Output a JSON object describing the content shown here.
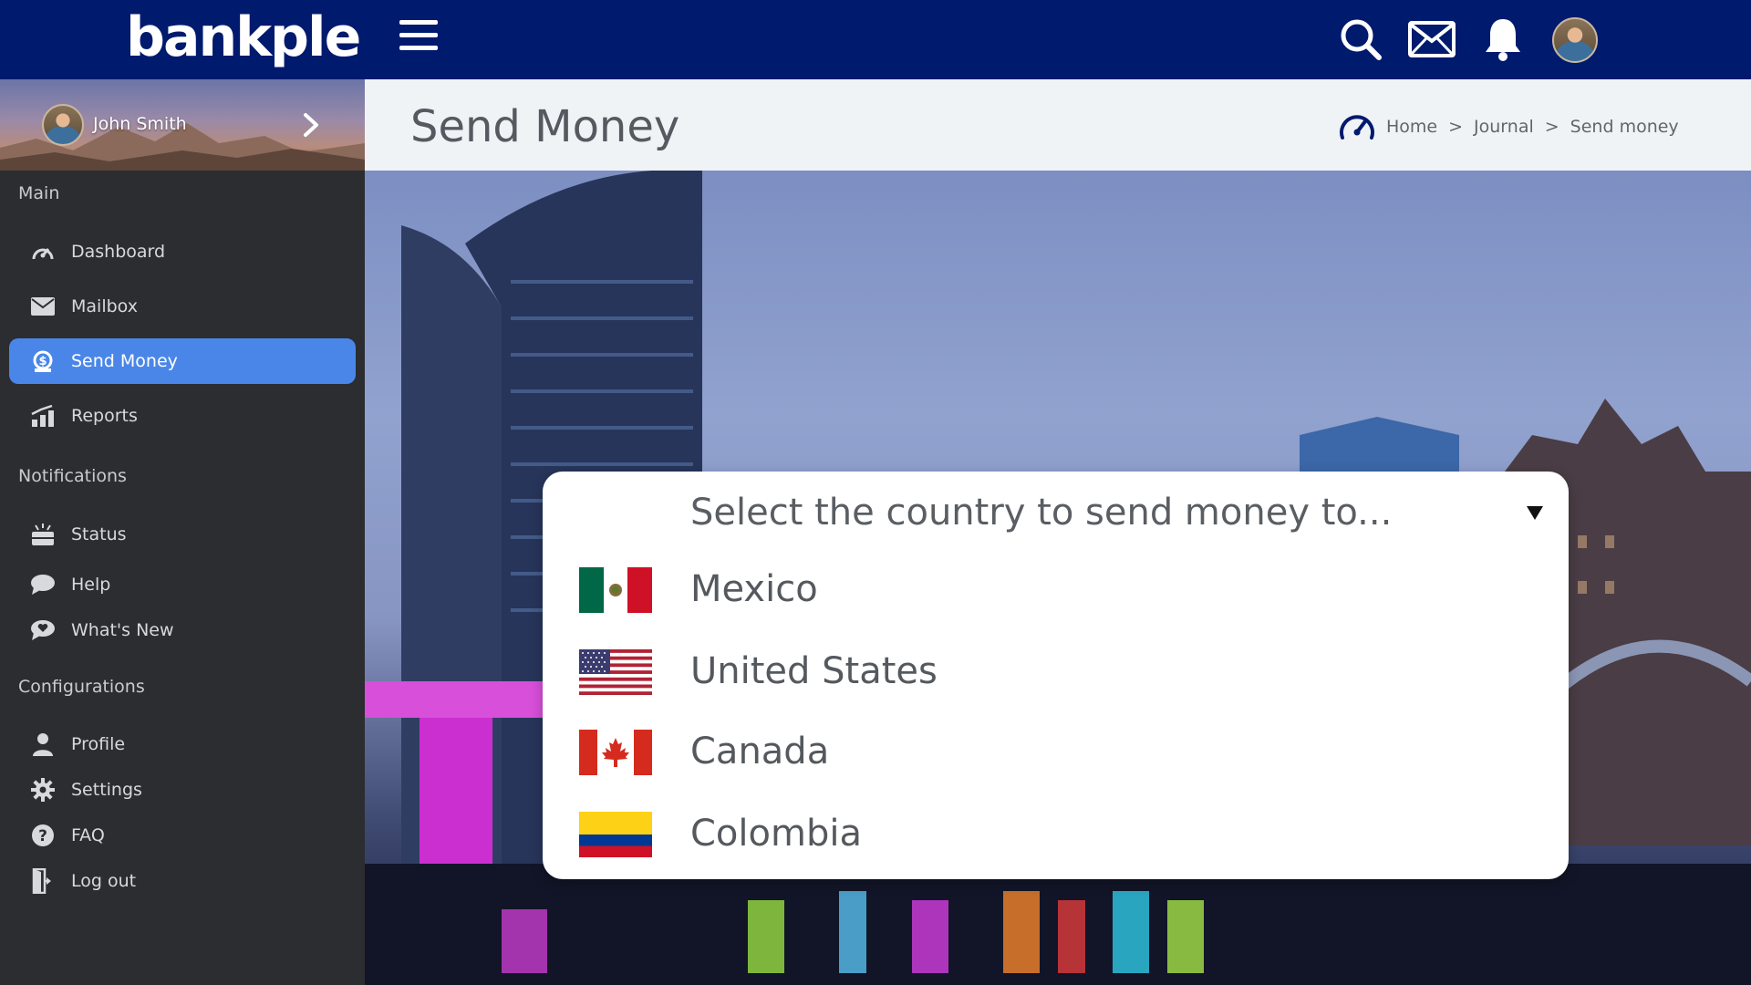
{
  "app": {
    "logo_text": "bankple",
    "brand_color": "#001a6e",
    "accent_color": "#4a86e8"
  },
  "topbar": {
    "icons": [
      "menu-icon",
      "search-icon",
      "mail-icon",
      "bell-icon",
      "avatar"
    ]
  },
  "user": {
    "name": "John Smith"
  },
  "sidebar": {
    "sections": {
      "main": "Main",
      "notifications": "Notifications",
      "configurations": "Configurations"
    },
    "items": {
      "dashboard": "Dashboard",
      "mailbox": "Mailbox",
      "send_money": "Send Money",
      "reports": "Reports",
      "status": "Status",
      "help": "Help",
      "whats_new": "What's New",
      "profile": "Profile",
      "settings": "Settings",
      "faq": "FAQ",
      "logout": "Log out"
    },
    "active_item": "send_money"
  },
  "page": {
    "title": "Send Money",
    "breadcrumb": [
      "Home",
      "Journal",
      "Send money"
    ],
    "breadcrumb_separator": ">"
  },
  "country_select": {
    "placeholder": "Select the country to send money to...",
    "options": [
      {
        "name": "Mexico",
        "flag": "mexico-flag"
      },
      {
        "name": "United States",
        "flag": "usa-flag"
      },
      {
        "name": "Canada",
        "flag": "canada-flag"
      },
      {
        "name": "Colombia",
        "flag": "colombia-flag"
      }
    ]
  }
}
